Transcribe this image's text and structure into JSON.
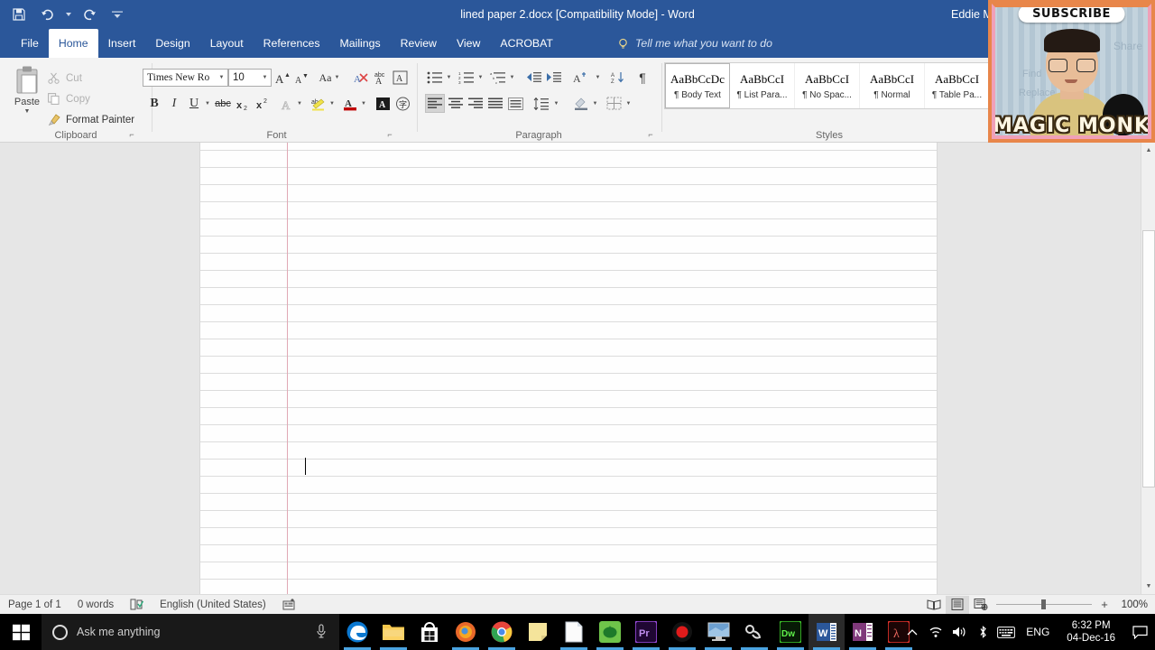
{
  "titlebar": {
    "document_title": "lined paper 2.docx [Compatibility Mode] - Word",
    "user": "Eddie Monk",
    "quick_access": [
      {
        "name": "save-icon",
        "label": "Save"
      },
      {
        "name": "undo-icon",
        "label": "Undo"
      },
      {
        "name": "redo-icon",
        "label": "Redo"
      },
      {
        "name": "customize-qat-icon",
        "label": "Customize Quick Access Toolbar"
      }
    ]
  },
  "ribbon": {
    "tabs": [
      {
        "label": "File",
        "active": false
      },
      {
        "label": "Home",
        "active": true
      },
      {
        "label": "Insert",
        "active": false
      },
      {
        "label": "Design",
        "active": false
      },
      {
        "label": "Layout",
        "active": false
      },
      {
        "label": "References",
        "active": false
      },
      {
        "label": "Mailings",
        "active": false
      },
      {
        "label": "Review",
        "active": false
      },
      {
        "label": "View",
        "active": false
      },
      {
        "label": "ACROBAT",
        "active": false
      }
    ],
    "tell_me": "Tell me what you want to do",
    "groups": {
      "clipboard": {
        "label": "Clipboard",
        "paste": "Paste",
        "cut": "Cut",
        "copy": "Copy",
        "format_painter": "Format Painter"
      },
      "font": {
        "label": "Font",
        "font_name": "Times New Ro",
        "font_size": "10",
        "buttons": [
          "Grow Font",
          "Shrink Font",
          "Change Case",
          "Clear Formatting",
          "Phonetic Guide",
          "Character Border",
          "Bold",
          "Italic",
          "Underline",
          "Strikethrough",
          "Subscript",
          "Superscript",
          "Text Effects",
          "Text Highlight Color",
          "Font Color",
          "Character Shading",
          "Enclose Characters"
        ]
      },
      "paragraph": {
        "label": "Paragraph",
        "buttons": [
          "Bullets",
          "Numbering",
          "Multilevel List",
          "Decrease Indent",
          "Increase Indent",
          "Sort",
          "Show/Hide",
          "Align Left",
          "Center",
          "Align Right",
          "Justify",
          "Distributed",
          "Line and Paragraph Spacing",
          "Shading",
          "Borders"
        ]
      },
      "styles": {
        "label": "Styles",
        "items": [
          {
            "preview": "AaBbCcDc",
            "name": "Body Text",
            "active": true
          },
          {
            "preview": "AaBbCcI",
            "name": "List Para...",
            "active": false
          },
          {
            "preview": "AaBbCcI",
            "name": "No Spac...",
            "active": false
          },
          {
            "preview": "AaBbCcI",
            "name": "Normal",
            "active": false
          },
          {
            "preview": "AaBbCcI",
            "name": "Table Pa...",
            "active": false
          }
        ]
      }
    }
  },
  "document": {
    "line_count": 26,
    "line_spacing_px": 19,
    "ruled_line_color": "#dcdcdc",
    "margin_line_color": "#e0a9b5",
    "page_background": "#fefefe",
    "workspace_background": "#e6e6e6",
    "body_text": ""
  },
  "scrollbar": {
    "up_arrow": "▲",
    "down_arrow": "▼"
  },
  "statusbar": {
    "page": "Page 1 of 1",
    "words": "0 words",
    "proofing_icon": "proofing-errors-icon",
    "language": "English (United States)",
    "macro_icon": "macro-record-icon",
    "views": [
      {
        "name": "read-mode",
        "selected": false
      },
      {
        "name": "print-layout",
        "selected": true
      },
      {
        "name": "web-layout",
        "selected": false
      }
    ],
    "zoom_out": "−",
    "zoom_in": "+",
    "zoom_level": "100%"
  },
  "taskbar": {
    "start_label": "Start",
    "cortana_placeholder": "Ask me anything",
    "mic_icon": "microphone-icon",
    "apps": [
      {
        "name": "edge",
        "label": "Microsoft Edge",
        "running": true
      },
      {
        "name": "file-explorer",
        "label": "File Explorer",
        "running": true
      },
      {
        "name": "store",
        "label": "Microsoft Store",
        "running": false
      },
      {
        "name": "firefox",
        "label": "Mozilla Firefox",
        "running": true
      },
      {
        "name": "chrome",
        "label": "Google Chrome",
        "running": true
      },
      {
        "name": "sticky-notes",
        "label": "Sticky Notes",
        "running": false
      },
      {
        "name": "notepad",
        "label": "Notepad",
        "running": true
      },
      {
        "name": "camtasia",
        "label": "Camtasia",
        "running": true
      },
      {
        "name": "premiere-pro",
        "label": "Adobe Premiere Pro",
        "running": true
      },
      {
        "name": "recorder",
        "label": "Screen Recorder",
        "running": true
      },
      {
        "name": "remote-desktop",
        "label": "Remote Desktop",
        "running": true
      },
      {
        "name": "snagit",
        "label": "Snagit",
        "running": true
      },
      {
        "name": "dreamweaver",
        "label": "Adobe Dreamweaver",
        "running": true
      },
      {
        "name": "word",
        "label": "Microsoft Word",
        "running": true
      },
      {
        "name": "onenote",
        "label": "Microsoft OneNote",
        "running": true
      },
      {
        "name": "acrobat",
        "label": "Adobe Acrobat",
        "running": true
      }
    ],
    "tray": {
      "show_hidden": "^",
      "network_icon": "wifi-icon",
      "volume_icon": "speaker-icon",
      "bluetooth_icon": "bluetooth-icon",
      "keyboard_icon": "touch-keyboard-icon",
      "language": "ENG",
      "time": "6:32 PM",
      "date": "04-Dec-16",
      "action_center": "notification-icon"
    }
  },
  "webcam_overlay": {
    "subscribe_text": "SUBSCRIBE",
    "channel_name": "MAGIC MONK",
    "ghost_labels": [
      "Share",
      "Find",
      "Replace"
    ],
    "border_color": "#e8864a",
    "accent_color": "#f0a0b8"
  },
  "colors": {
    "word_blue": "#2b579a",
    "ribbon_bg": "#f3f3f3",
    "workspace": "#e6e6e6",
    "taskbar": "#000000",
    "accent_highlight": "#4aa3e0"
  }
}
